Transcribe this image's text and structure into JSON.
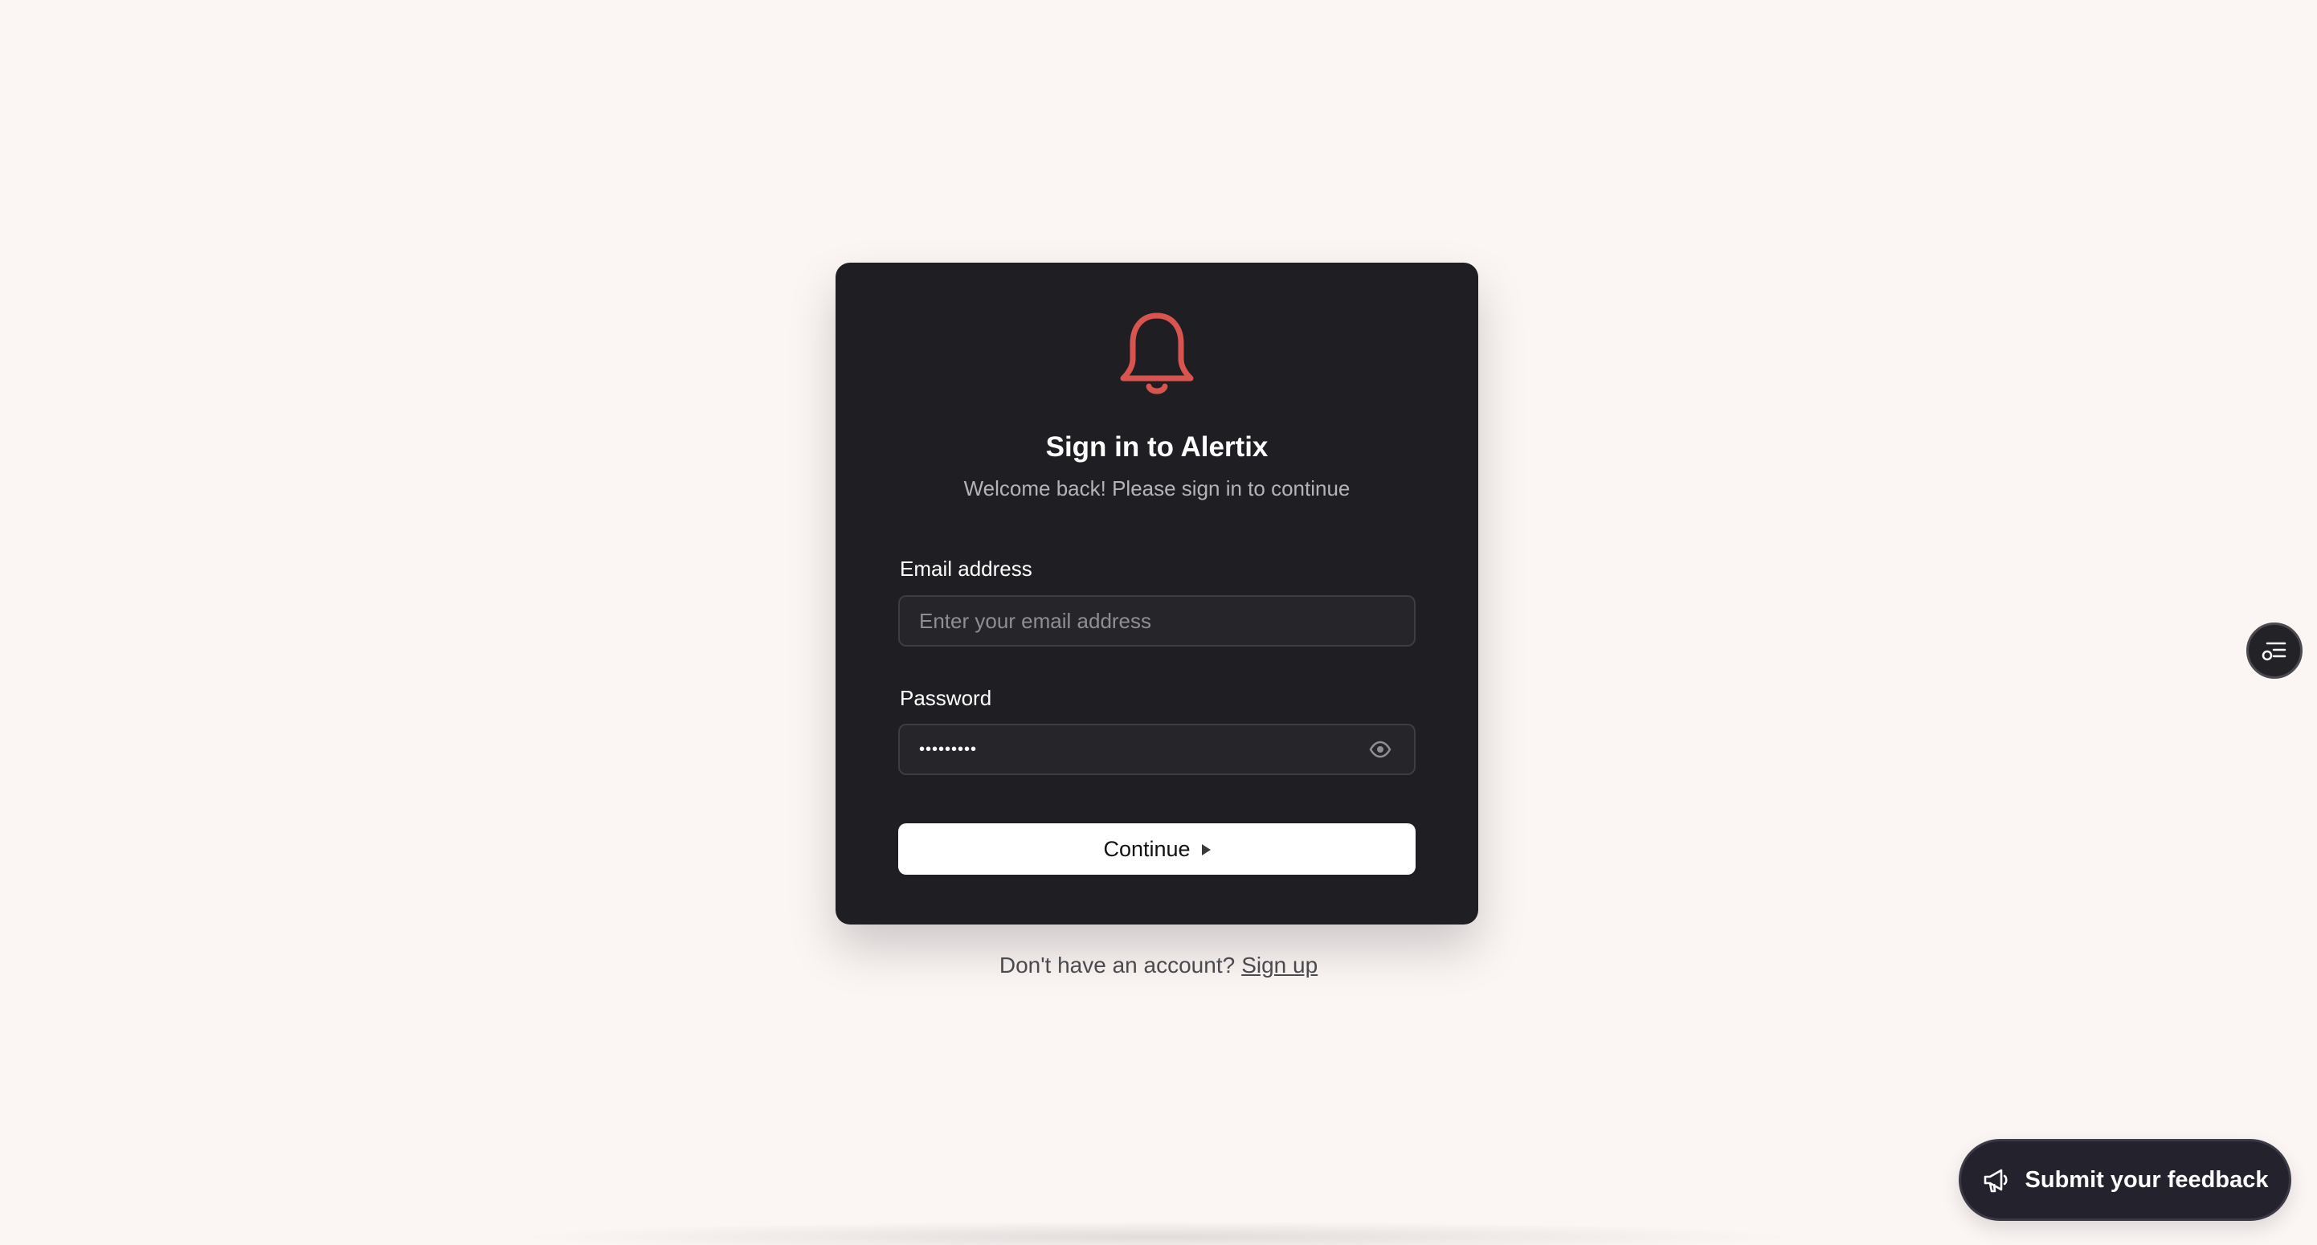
{
  "signin": {
    "title": "Sign in to Alertix",
    "subtitle": "Welcome back! Please sign in to continue",
    "logo_icon": "bell-icon",
    "email_label": "Email address",
    "email_placeholder": "Enter your email address",
    "email_value": "",
    "password_label": "Password",
    "password_masked": "•••••••••",
    "password_toggle_icon": "eye-icon",
    "continue_label": "Continue",
    "continue_icon": "play-arrow-icon"
  },
  "footer": {
    "prompt": "Don't have an account?",
    "signup_link": "Sign up"
  },
  "floating": {
    "side_button_icon": "list-settings-icon",
    "feedback_label": "Submit your feedback",
    "feedback_icon": "megaphone-icon"
  },
  "colors": {
    "page_bg": "#fbf5f4",
    "card_bg": "#1f1f23",
    "accent": "#d9534f",
    "button_bg": "#ffffff",
    "feedback_bg": "#23222d"
  }
}
